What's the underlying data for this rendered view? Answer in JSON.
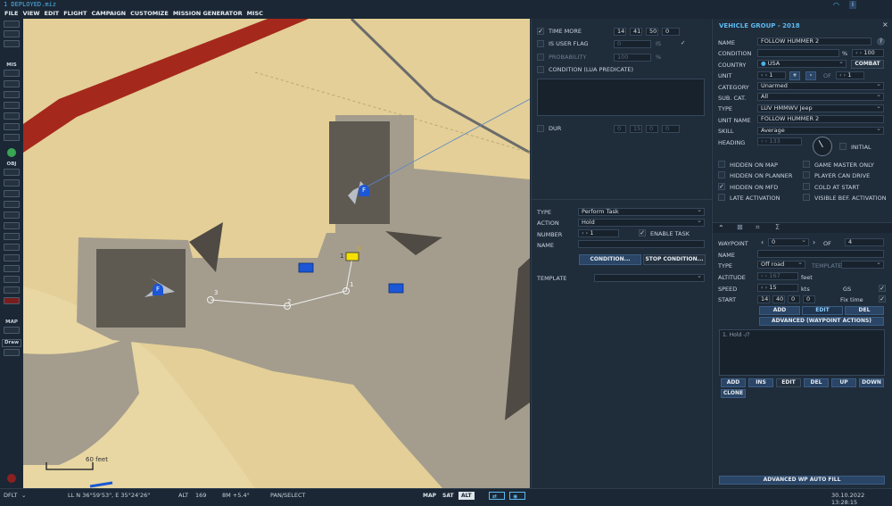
{
  "title": "1 DEPLOYED.miz",
  "menu": [
    "FILE",
    "VIEW",
    "EDIT",
    "FLIGHT",
    "CAMPAIGN",
    "CUSTOMIZE",
    "MISSION GENERATOR",
    "MISC"
  ],
  "toolbar": {
    "mis_label": "MIS",
    "obj_label": "OBJ",
    "map_label": "MAP",
    "draw_label": "Draw"
  },
  "map": {
    "scale_label": "60 feet",
    "waypoint_labels": [
      "0",
      "1",
      "2",
      "3",
      "1"
    ],
    "unit_marker": "F"
  },
  "status": {
    "layer": "DFLT",
    "coords": "LL  N 36°59'53\", E 35°24'26\"",
    "alt_label": "ALT",
    "alt_value": "169",
    "mag": "8M  +5.4°",
    "mode": "PAN/SELECT",
    "btn_map": "MAP",
    "btn_sat": "SAT",
    "btn_alt": "ALT",
    "datetime": "30.10.2022 13:28:15"
  },
  "trigger": {
    "time_more_label": "TIME MORE",
    "time_more": [
      "14",
      "41",
      "50",
      "0"
    ],
    "is_user_flag_label": "IS USER FLAG",
    "flag_value": "0",
    "is_label": "IS",
    "probability_label": "PROBABILITY",
    "probability_value": "100",
    "percent": "%",
    "condition_lua_label": "CONDITION (LUA PREDICATE)",
    "dur_label": "DUR",
    "dur": [
      "0",
      "15",
      "0",
      "0"
    ],
    "type_label": "TYPE",
    "type_value": "Perform Task",
    "action_label": "ACTION",
    "action_value": "Hold",
    "number_label": "NUMBER",
    "number_value": "1",
    "enable_task_label": "ENABLE TASK",
    "name_label": "NAME",
    "condition_btn": "CONDITION...",
    "stop_condition_btn": "STOP CONDITION...",
    "template_label": "TEMPLATE"
  },
  "vehicle": {
    "header": "VEHICLE GROUP - 2018",
    "name_label": "NAME",
    "name_value": "FOLLOW HUMMER 2",
    "help": "?",
    "condition_label": "CONDITION",
    "condition_pct": "%",
    "condition_value": "100",
    "country_label": "COUNTRY",
    "country_value": "USA",
    "combat_btn": "COMBAT",
    "unit_label": "UNIT",
    "unit_value": "1",
    "plus": "+",
    "minus": "-",
    "of_label": "OF",
    "unit_of": "1",
    "category_label": "CATEGORY",
    "category_value": "Unarmed",
    "subcat_label": "SUB. CAT.",
    "subcat_value": "All",
    "type_label": "TYPE",
    "type_value": "LUV HMMWV Jeep",
    "unit_name_label": "UNIT NAME",
    "unit_name_value": "FOLLOW HUMMER 2",
    "skill_label": "SKILL",
    "skill_value": "Average",
    "heading_label": "HEADING",
    "heading_value": "133",
    "initial_label": "INITIAL",
    "checks": [
      {
        "label": "HIDDEN ON MAP",
        "checked": ""
      },
      {
        "label": "GAME MASTER ONLY",
        "checked": ""
      },
      {
        "label": "HIDDEN ON PLANNER",
        "checked": ""
      },
      {
        "label": "PLAYER CAN DRIVE",
        "checked": ""
      },
      {
        "label": "HIDDEN ON MFD",
        "checked": "✓"
      },
      {
        "label": "COLD AT START",
        "checked": ""
      },
      {
        "label": "LATE ACTIVATION",
        "checked": ""
      },
      {
        "label": "VISIBLE BEF. ACTIVATION",
        "checked": ""
      }
    ],
    "waypoint_label": "WAYPOINT",
    "waypoint_value": "0",
    "wp_of_label": "OF",
    "wp_of_value": "4",
    "wp_name_label": "NAME",
    "wp_type_label": "TYPE",
    "wp_type_value": "Off road",
    "wp_template_label": "TEMPLATE",
    "altitude_label": "ALTITUDE",
    "altitude_value": "167",
    "altitude_unit": "feet",
    "speed_label": "SPEED",
    "speed_value": "15",
    "speed_unit": "kts",
    "gs_label": "GS",
    "start_label": "START",
    "start_values": [
      "14",
      "40",
      "0",
      "0"
    ],
    "fix_time_label": "Fix time",
    "btn_add": "ADD",
    "btn_edit": "EDIT",
    "btn_del": "DEL",
    "advanced_wp_actions": "ADVANCED (WAYPOINT ACTIONS)",
    "action_item": "1. Hold -/?",
    "list_btns": [
      "ADD",
      "INS",
      "EDIT",
      "DEL",
      "UP",
      "DOWN"
    ],
    "clone_btn": "CLONE",
    "auto_fill": "ADVANCED WP AUTO FILL",
    "close": "×"
  }
}
